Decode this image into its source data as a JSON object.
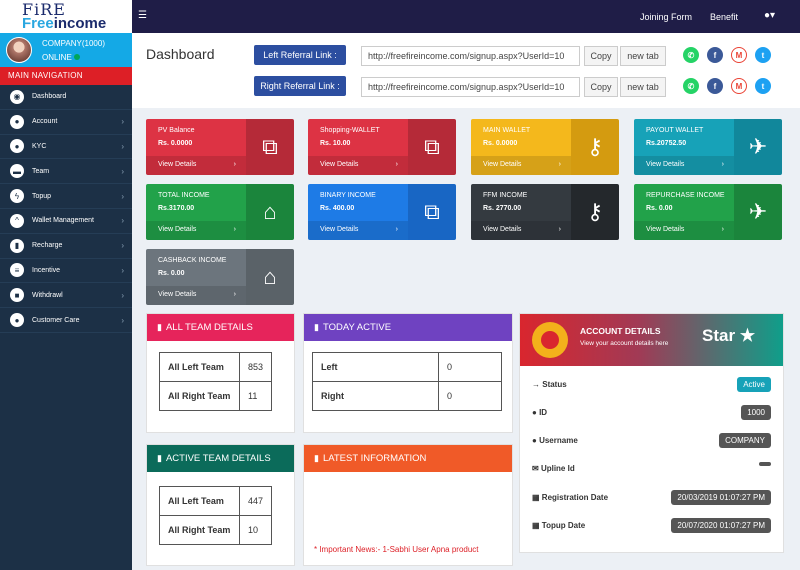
{
  "logo": {
    "line1": "FiRE",
    "line2a": "Free",
    "line2b": "income"
  },
  "user": {
    "name": "COMPANY(1000)",
    "status": "ONLINE"
  },
  "nav": {
    "heading": "MAIN NAVIGATION",
    "items": [
      {
        "label": "Dashboard"
      },
      {
        "label": "Account"
      },
      {
        "label": "KYC"
      },
      {
        "label": "Team"
      },
      {
        "label": "Topup"
      },
      {
        "label": "Wallet Management"
      },
      {
        "label": "Recharge"
      },
      {
        "label": "Incentive"
      },
      {
        "label": "Withdrawl"
      },
      {
        "label": "Customer Care"
      }
    ]
  },
  "topbar": {
    "joining_form": "Joining Form",
    "benefit": "Benefit"
  },
  "header": {
    "title": "Dashboard",
    "left_label": "Left Referral Link :",
    "left_url": "http://freefireincome.com/signup.aspx?UserId=10",
    "right_label": "Right Referral Link :",
    "right_url": "http://freefireincome.com/signup.aspx?UserId=10",
    "copy": "Copy",
    "new_tab": "new tab"
  },
  "boxes": [
    {
      "title": "PV Balance",
      "value": "Rs. 0.0000",
      "link": "View Details",
      "icon": "sitemap-icon",
      "color": "#dd3344",
      "dark": "#b52a38"
    },
    {
      "title": "Shopping-WALLET",
      "value": "Rs. 10.00",
      "link": "View Details",
      "icon": "sitemap-icon",
      "color": "#dd3344",
      "dark": "#b52a38"
    },
    {
      "title": "MAIN WALLET",
      "value": "Rs. 0.0000",
      "link": "View Details",
      "icon": "key-icon",
      "color": "#f4b81c",
      "dark": "#d49b10"
    },
    {
      "title": "PAYOUT WALLET",
      "value": "Rs.20752.50",
      "link": "View Details",
      "icon": "plane-icon",
      "color": "#17a2b8",
      "dark": "#11879b"
    },
    {
      "title": "TOTAL INCOME",
      "value": "Rs.3170.00",
      "link": "View Details",
      "icon": "bank-icon",
      "color": "#22a24a",
      "dark": "#1b853c"
    },
    {
      "title": "BINARY INCOME",
      "value": "Rs. 400.00",
      "link": "View Details",
      "icon": "sitemap-icon",
      "color": "#1e7be6",
      "dark": "#1866c4"
    },
    {
      "title": "FFM INCOME",
      "value": "Rs. 2770.00",
      "link": "View Details",
      "icon": "key-icon",
      "color": "#343a40",
      "dark": "#24282c"
    },
    {
      "title": "REPURCHASE INCOME",
      "value": "Rs. 0.00",
      "link": "View Details",
      "icon": "plane-icon",
      "color": "#22a24a",
      "dark": "#1b853c"
    },
    {
      "title": "CASHBACK INCOME",
      "value": "Rs. 0.00",
      "link": "View Details",
      "icon": "bank-icon",
      "color": "#6c757d",
      "dark": "#5a6268"
    }
  ],
  "all_team": {
    "title": "ALL TEAM DETAILS",
    "left_label": "All Left Team",
    "left_value": "853",
    "right_label": "All Right Team",
    "right_value": "11"
  },
  "today_active": {
    "title": "TODAY ACTIVE",
    "left_label": "Left",
    "left_value": "0",
    "right_label": "Right",
    "right_value": "0"
  },
  "active_team": {
    "title": "ACTIVE TEAM DETAILS",
    "left_label": "All Left Team",
    "left_value": "447",
    "right_label": "All Right Team",
    "right_value": "10"
  },
  "latest": {
    "title": "LATEST INFORMATION",
    "ticker": "* Important News:- 1-Sabhi User Apna product"
  },
  "account": {
    "title": "ACCOUNT DETAILS",
    "subtitle": "View your account details here",
    "star": "Star",
    "rows": [
      {
        "label": "Status",
        "value": "Active"
      },
      {
        "label": "ID",
        "value": "1000"
      },
      {
        "label": "Username",
        "value": "COMPANY"
      },
      {
        "label": "Upline Id",
        "value": ""
      },
      {
        "label": "Registration Date",
        "value": "20/03/2019 01:07:27 PM"
      },
      {
        "label": "Topup Date",
        "value": "20/07/2020 01:07:27 PM"
      }
    ]
  }
}
